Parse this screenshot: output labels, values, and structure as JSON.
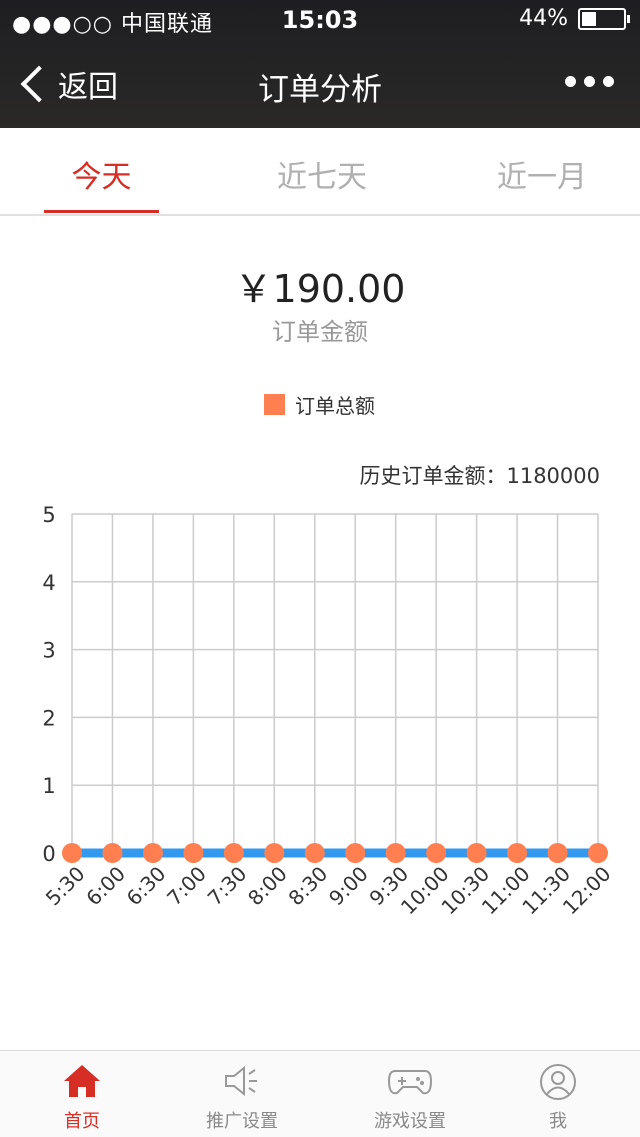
{
  "status_bar": {
    "carrier": "●●●○○ 中国联通",
    "time": "15:03",
    "battery": "44%"
  },
  "header": {
    "back_label": "返回",
    "title": "订单分析"
  },
  "tabs": [
    {
      "label": "今天",
      "active": true
    },
    {
      "label": "近七天",
      "active": false
    },
    {
      "label": "近一月",
      "active": false
    }
  ],
  "summary": {
    "amount": "￥190.00",
    "amount_label": "订单金额"
  },
  "history": {
    "text": "历史订单金额：1180000"
  },
  "chart_data": {
    "type": "line",
    "x": [
      "5:30",
      "6:00",
      "6:30",
      "7:00",
      "7:30",
      "8:00",
      "8:30",
      "9:00",
      "9:30",
      "10:00",
      "10:30",
      "11:00",
      "11:30",
      "12:00"
    ],
    "series": [
      {
        "name": "订单总额",
        "values": [
          0,
          0,
          0,
          0,
          0,
          0,
          0,
          0,
          0,
          0,
          0,
          0,
          0,
          0
        ],
        "color": "#3399ee",
        "marker_color": "#ff7f50"
      }
    ],
    "ylim": [
      0,
      5
    ],
    "yticks": [
      0,
      1,
      2,
      3,
      4,
      5
    ],
    "grid": true,
    "legend": "top-center"
  },
  "bottom_nav": [
    {
      "label": "首页",
      "icon": "home-icon",
      "active": true
    },
    {
      "label": "推广设置",
      "icon": "megaphone-icon",
      "active": false
    },
    {
      "label": "游戏设置",
      "icon": "gamepad-icon",
      "active": false
    },
    {
      "label": "我",
      "icon": "user-icon",
      "active": false
    }
  ],
  "colors": {
    "accent": "#d62d25",
    "legend_swatch": "#ff7f50",
    "line": "#3399ee"
  }
}
